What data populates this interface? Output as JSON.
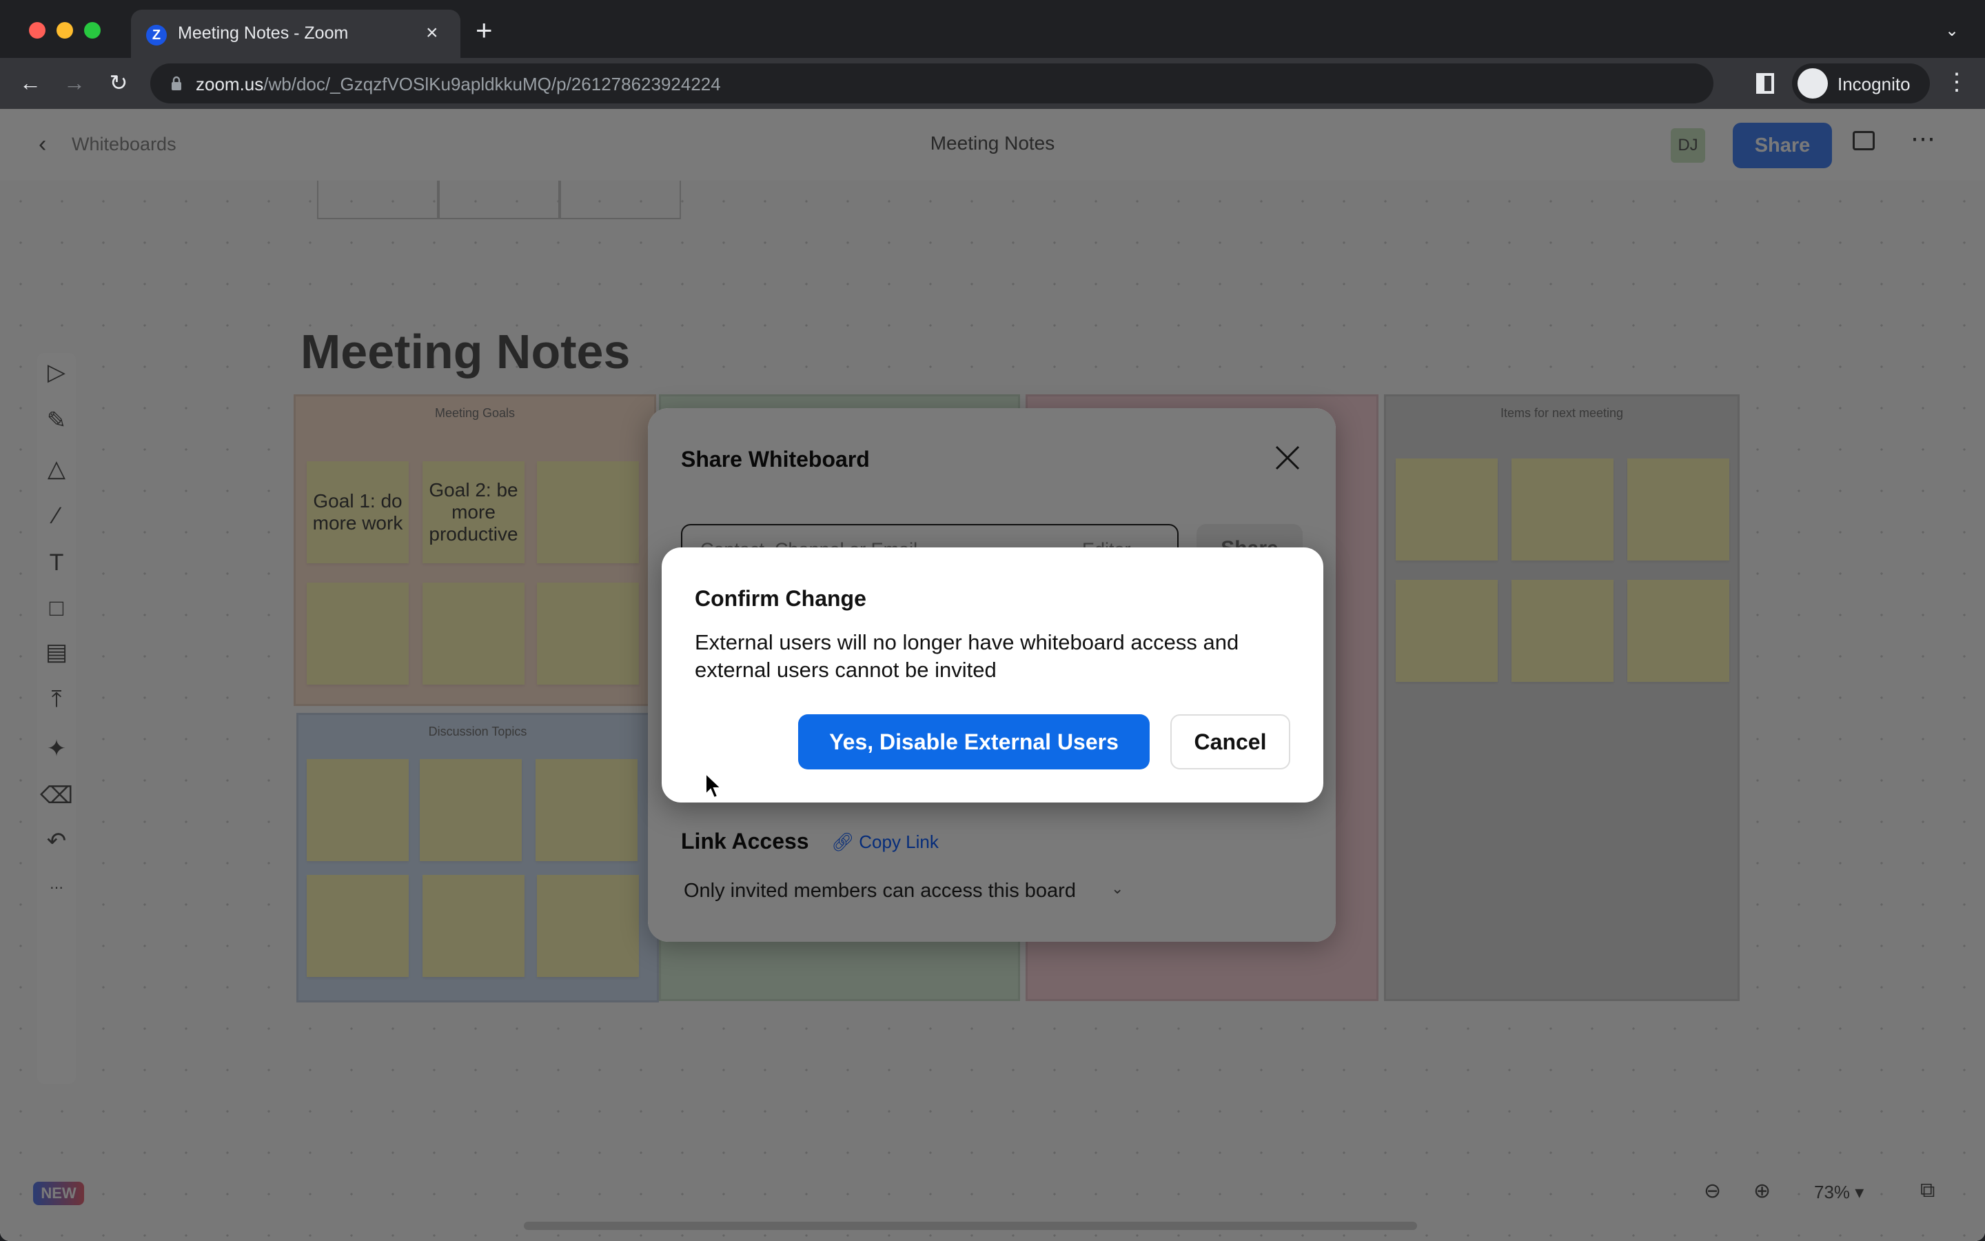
{
  "browser": {
    "tab_title": "Meeting Notes - Zoom",
    "tab_favicon_letter": "Z",
    "tab_close": "×",
    "new_tab": "+",
    "url_host": "zoom.us",
    "url_path": "/wb/doc/_GzqzfVOSlKu9apldkkuMQ/p/261278623924224",
    "profile_label": "Incognito",
    "colors": {
      "close": "#ff5f57",
      "minimize": "#febc2e",
      "zoom": "#28c840"
    }
  },
  "appbar": {
    "back_label": "Whiteboards",
    "board_title": "Meeting Notes",
    "avatar_initials": "DJ",
    "share_label": "Share"
  },
  "toolbar": {
    "tools": [
      "select",
      "pen",
      "shapes",
      "line",
      "text",
      "sticky-note",
      "template",
      "upload",
      "stickers",
      "eraser",
      "undo",
      "more"
    ]
  },
  "canvas": {
    "title": "Meeting Notes",
    "frames": [
      {
        "label": "Meeting Goals",
        "stickies": [
          "Goal 1: do more work",
          "Goal 2: be more productive",
          "",
          "",
          "",
          ""
        ]
      },
      {
        "label": "",
        "stickies": []
      },
      {
        "label": "",
        "stickies": []
      },
      {
        "label": "Items for next meeting",
        "stickies": [
          "",
          "",
          "",
          "",
          "",
          ""
        ]
      },
      {
        "label": "Discussion Topics",
        "stickies": [
          "",
          "",
          "",
          "",
          "",
          ""
        ]
      }
    ]
  },
  "footer": {
    "new_badge": "NEW",
    "zoom_level": "73%"
  },
  "share_dialog": {
    "title": "Share Whiteboard",
    "invite_placeholder": "Contact, Channel or Email",
    "role": "Editor",
    "share_button": "Share",
    "link_access_label": "Link Access",
    "copy_link": "Copy Link",
    "access_option": "Only invited members can access this board"
  },
  "confirm_dialog": {
    "title": "Confirm Change",
    "message": "External users will no longer have whiteboard access and external users cannot be invited",
    "confirm_button": "Yes, Disable External Users",
    "cancel_button": "Cancel",
    "accent_color": "#0e6ae6"
  }
}
